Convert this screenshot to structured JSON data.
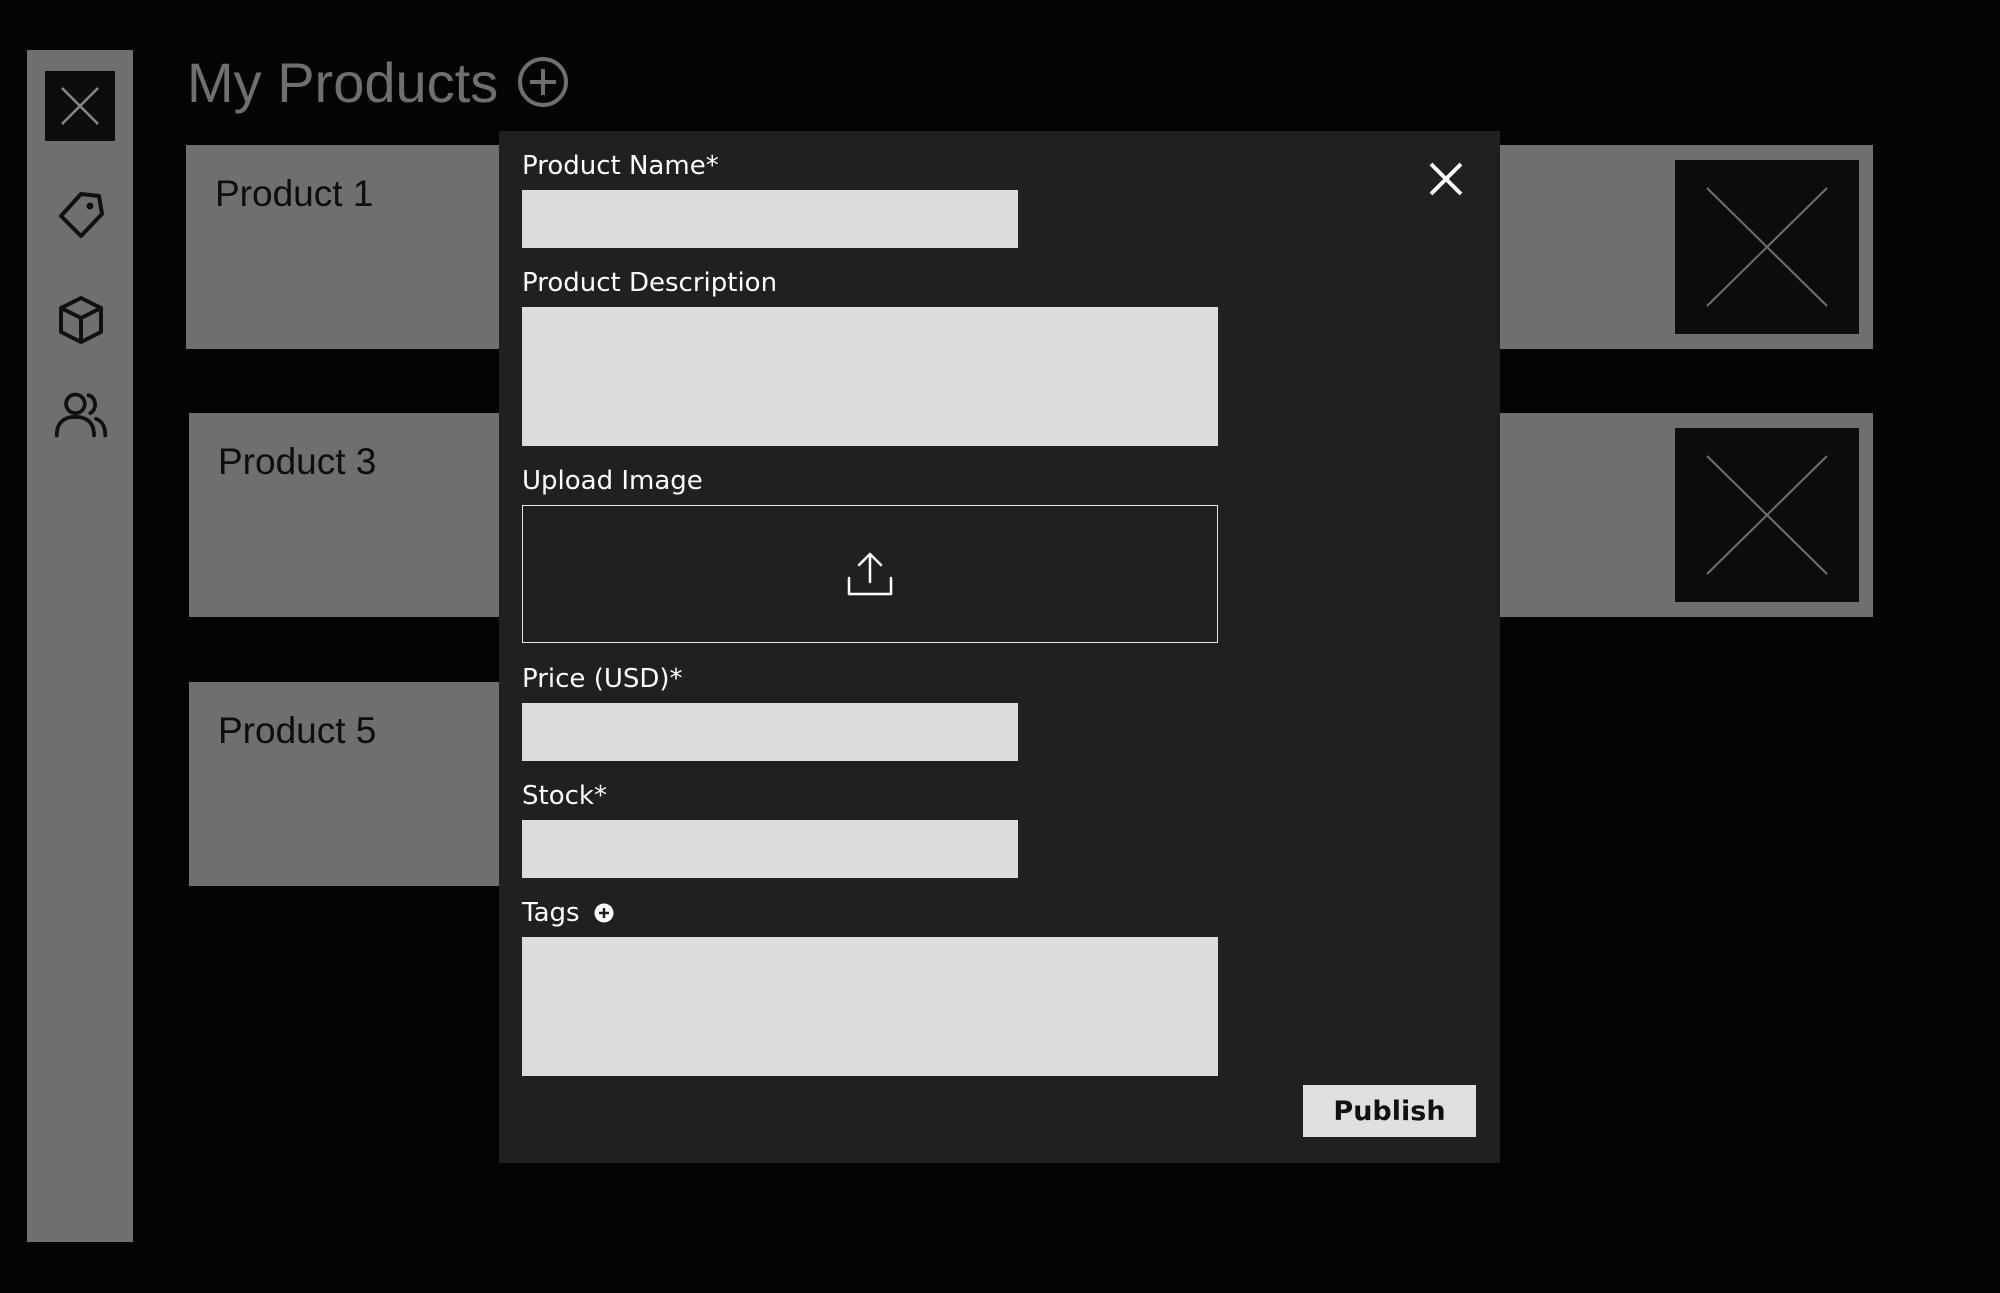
{
  "header": {
    "title": "My Products"
  },
  "sidebar": {
    "items": [
      {
        "name": "close-icon"
      },
      {
        "name": "tag-icon"
      },
      {
        "name": "box-icon"
      },
      {
        "name": "users-icon"
      }
    ]
  },
  "products": [
    {
      "title": "Product 1"
    },
    {
      "title": "Product 3"
    },
    {
      "title": "Product 5"
    }
  ],
  "modal": {
    "fields": {
      "name": {
        "label": "Product Name*",
        "value": ""
      },
      "description": {
        "label": "Product Description",
        "value": ""
      },
      "image": {
        "label": "Upload Image"
      },
      "price": {
        "label": "Price (USD)*",
        "value": ""
      },
      "stock": {
        "label": "Stock*",
        "value": ""
      },
      "tags": {
        "label": "Tags",
        "value": ""
      }
    },
    "publish_label": "Publish"
  },
  "colors": {
    "background": "#040404",
    "panel": "#6f6f6f",
    "modal": "#202020",
    "input": "#dcdcdc"
  }
}
